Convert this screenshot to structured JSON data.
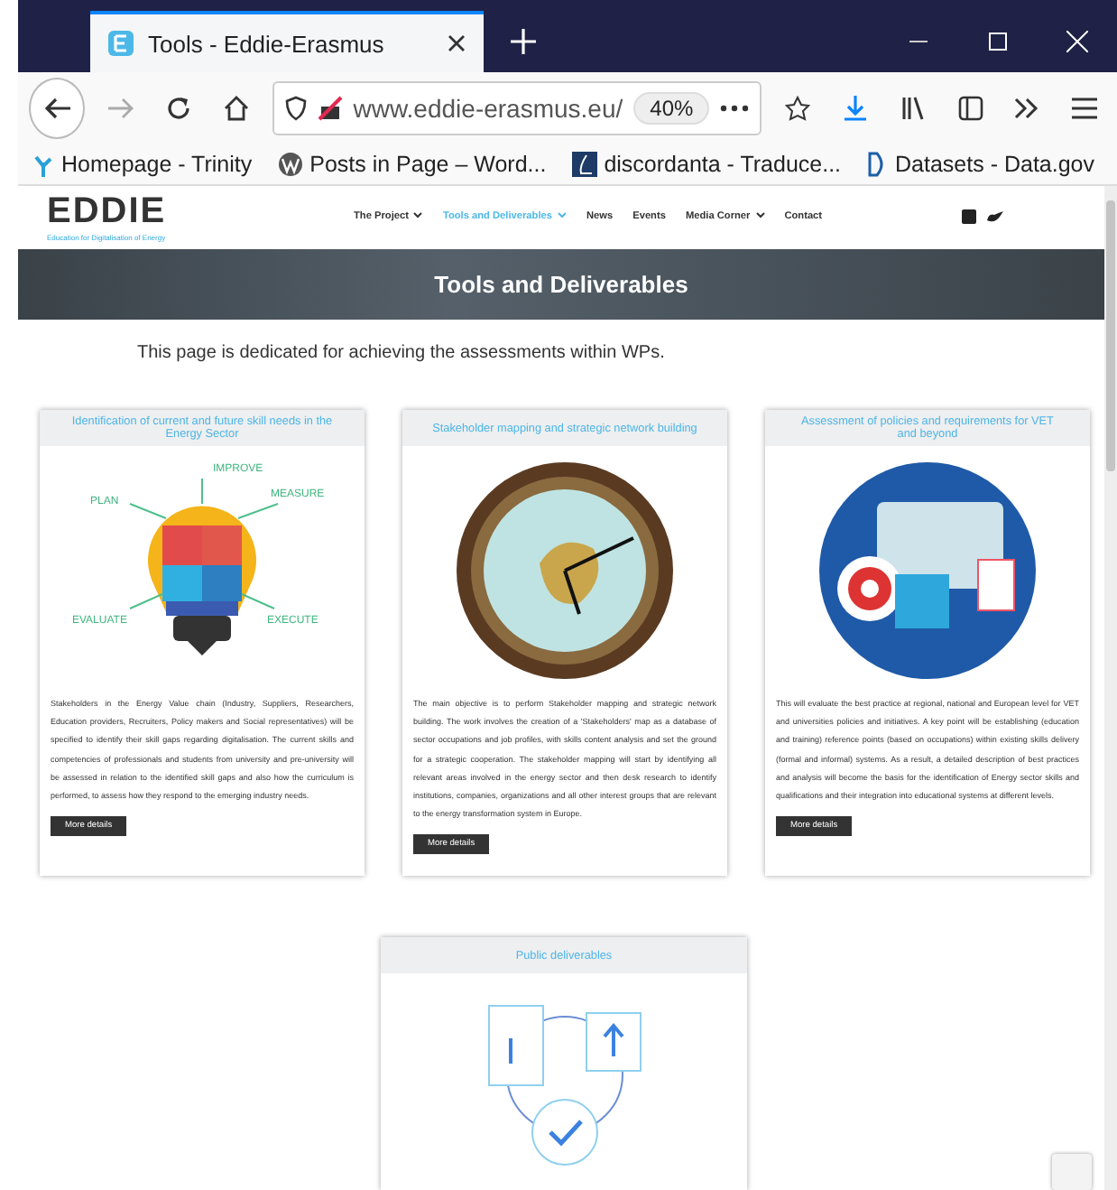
{
  "browser": {
    "tab_title": "Tools - Eddie-Erasmus",
    "url": "www.eddie-erasmus.eu/",
    "zoom": "40%",
    "bookmarks": [
      {
        "label": "Homepage - Trinity",
        "kind": "tree"
      },
      {
        "label": "Posts in Page – Word...",
        "kind": "wp"
      },
      {
        "label": "discordanta - Traduce...",
        "kind": "letter"
      },
      {
        "label": "Datasets - Data.gov",
        "kind": "d"
      }
    ]
  },
  "site": {
    "logo": "EDDIE",
    "logo_tagline": "Education for Digitalisation of Energy",
    "nav": [
      {
        "label": "The Project",
        "dropdown": true,
        "selected": false
      },
      {
        "label": "Tools and Deliverables",
        "dropdown": true,
        "selected": true
      },
      {
        "label": "News",
        "dropdown": false,
        "selected": false
      },
      {
        "label": "Events",
        "dropdown": false,
        "selected": false
      },
      {
        "label": "Media Corner",
        "dropdown": true,
        "selected": false
      },
      {
        "label": "Contact",
        "dropdown": false,
        "selected": false
      }
    ],
    "hero_title": "Tools and Deliverables",
    "intro": "This page is dedicated for achieving the assessments within WPs.",
    "cards": [
      {
        "title": "Identification of current and future skill needs in the Energy Sector",
        "kind": "bulb",
        "labels": [
          "IMPROVE",
          "PLAN",
          "MEASURE",
          "EVALUATE",
          "EXECUTE"
        ],
        "text": "Stakeholders in the Energy Value chain (Industry, Suppliers, Researchers, Education providers, Recruiters, Policy makers and Social representatives) will be specified to identify their skill gaps regarding digitalisation. The current skills and competencies of professionals and students from university and pre-university will be assessed in relation to the identified skill gaps and also how the curriculum is performed, to assess how they respond to the emerging industry needs.",
        "button": "More details"
      },
      {
        "title": "Stakeholder mapping and strategic network building",
        "kind": "clock",
        "text": "The main objective is to perform Stakeholder mapping and strategic network building. The work involves the creation of a 'Stakeholders' map as a database of sector occupations and job profiles, with skills content analysis and set the ground for a strategic cooperation. The stakeholder mapping will start by identifying all relevant areas involved in the energy sector and then desk research to identify institutions, companies, organizations and all other interest groups that are relevant to the energy transformation system in Europe.",
        "button": "More details"
      },
      {
        "title": "Assessment of policies and requirements for VET and beyond",
        "kind": "monitor",
        "text": "This will evaluate the best practice at regional, national and European level for VET and universities policies and initiatives. A key point will be establishing (education and training) reference points (based on occupations) within existing skills delivery (formal and informal) systems. As a result, a detailed description of best practices and analysis will become the basis for the identification of  Energy sector skills and qualifications and their integration into educational systems at different levels.",
        "button": "More details"
      },
      {
        "title": "Public deliverables",
        "kind": "documents"
      }
    ]
  }
}
